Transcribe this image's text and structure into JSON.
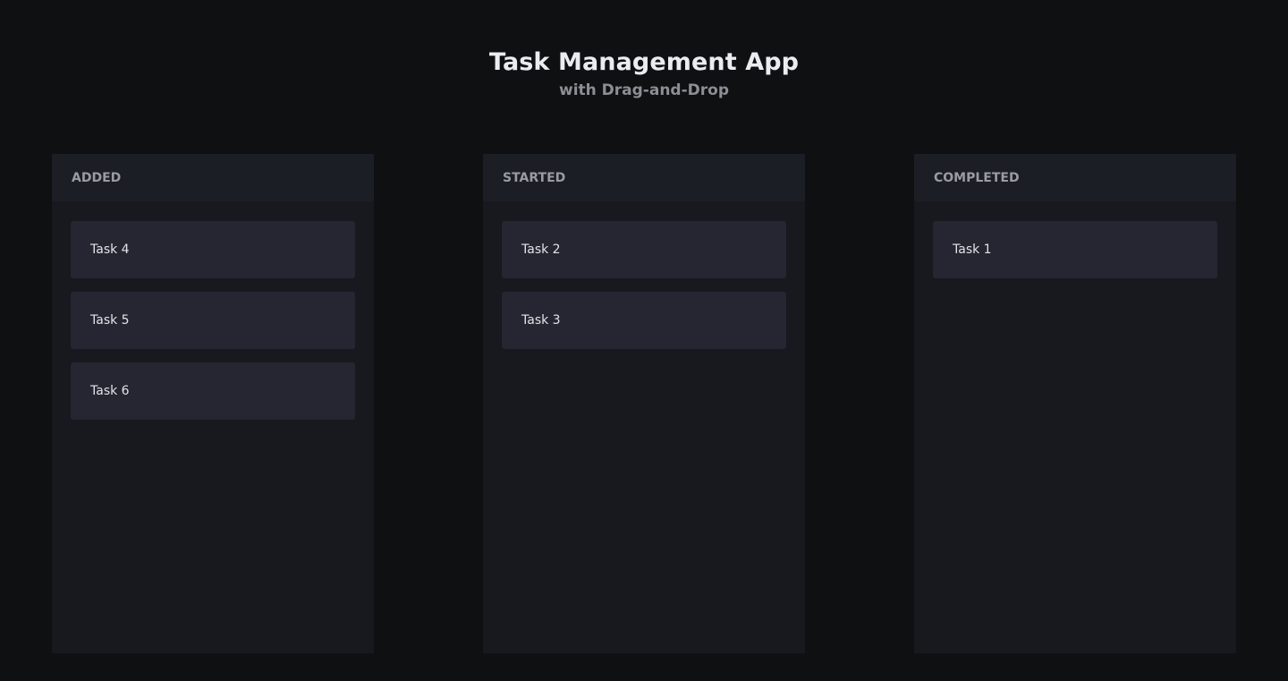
{
  "header": {
    "title": "Task Management App",
    "subtitle": "with Drag-and-Drop"
  },
  "columns": [
    {
      "label": "ADDED",
      "tasks": [
        {
          "label": "Task 4"
        },
        {
          "label": "Task 5"
        },
        {
          "label": "Task 6"
        }
      ]
    },
    {
      "label": "STARTED",
      "tasks": [
        {
          "label": "Task 2"
        },
        {
          "label": "Task 3"
        }
      ]
    },
    {
      "label": "COMPLETED",
      "tasks": [
        {
          "label": "Task 1"
        }
      ]
    }
  ],
  "colors": {
    "background": "#0f1012",
    "column": "#18191e",
    "column_header": "#1c1e25",
    "card": "#252631"
  }
}
